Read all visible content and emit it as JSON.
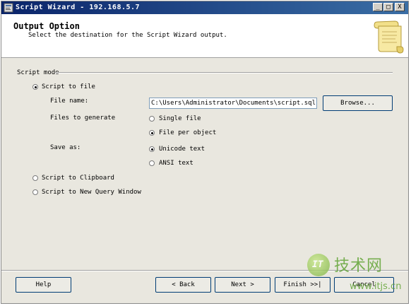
{
  "window": {
    "title": "Script Wizard - 192.168.5.7",
    "controls": {
      "minimize": "_",
      "maximize": "□",
      "close": "X"
    }
  },
  "header": {
    "title": "Output Option",
    "subtitle": "Select the destination for the Script Wizard output.",
    "icon": "scroll-icon"
  },
  "script_mode": {
    "group_label": "Script mode",
    "options": [
      {
        "label": "Script to file",
        "selected": true
      },
      {
        "label": "Script to Clipboard",
        "selected": false
      },
      {
        "label": "Script to New Query Window",
        "selected": false
      }
    ],
    "file_name_label": "File name:",
    "file_name_value": "C:\\Users\\Administrator\\Documents\\script.sql",
    "browse_label": "Browse...",
    "files_to_generate_label": "Files to generate",
    "files_to_generate": [
      {
        "label": "Single file",
        "selected": false
      },
      {
        "label": "File per object",
        "selected": true
      }
    ],
    "save_as_label": "Save as:",
    "save_as": [
      {
        "label": "Unicode text",
        "selected": true
      },
      {
        "label": "ANSI text",
        "selected": false
      }
    ]
  },
  "footer": {
    "help": "Help",
    "back": "< Back",
    "next": "Next >",
    "finish": "Finish >>|",
    "cancel": "Cancel"
  },
  "watermark": {
    "logo": "IT",
    "text": "技术网",
    "url": "www.itjs.cn"
  }
}
